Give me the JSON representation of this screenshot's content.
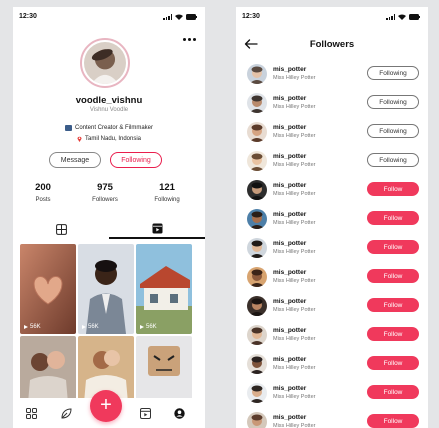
{
  "status": {
    "time": "12:30"
  },
  "profile": {
    "username": "voodle_vishnu",
    "full_name": "Vishnu Voodle",
    "bio_line_1": "Content Creator & Filmmaker",
    "bio_line_2": "Tamil Nadu, Indonsia",
    "message_label": "Message",
    "following_label": "Following",
    "stats": [
      {
        "value": "200",
        "label": "Posts"
      },
      {
        "value": "975",
        "label": "Followers"
      },
      {
        "value": "121",
        "label": "Following"
      }
    ],
    "grid": [
      {
        "views": "56K"
      },
      {
        "views": "56K"
      },
      {
        "views": "56K"
      },
      {
        "views": ""
      },
      {
        "views": ""
      },
      {
        "views": ""
      }
    ]
  },
  "followers": {
    "title": "Followers",
    "items": [
      {
        "username": "mis_potter",
        "name": "Miss Hilley Potter",
        "button": "Following",
        "state": "following"
      },
      {
        "username": "mis_potter",
        "name": "Miss Hilley Potter",
        "button": "Following",
        "state": "following"
      },
      {
        "username": "mis_potter",
        "name": "Miss Hilley Potter",
        "button": "Following",
        "state": "following"
      },
      {
        "username": "mis_potter",
        "name": "Miss Hilley Potter",
        "button": "Following",
        "state": "following"
      },
      {
        "username": "mis_potter",
        "name": "Miss Hilley Potter",
        "button": "Follow",
        "state": "follow"
      },
      {
        "username": "mis_potter",
        "name": "Miss Hilley Potter",
        "button": "Follow",
        "state": "follow"
      },
      {
        "username": "mis_potter",
        "name": "Miss Hilley Potter",
        "button": "Follow",
        "state": "follow"
      },
      {
        "username": "mis_potter",
        "name": "Miss Hilley Potter",
        "button": "Follow",
        "state": "follow"
      },
      {
        "username": "mis_potter",
        "name": "Miss Hilley Potter",
        "button": "Follow",
        "state": "follow"
      },
      {
        "username": "mis_potter",
        "name": "Miss Hilley Potter",
        "button": "Follow",
        "state": "follow"
      },
      {
        "username": "mis_potter",
        "name": "Miss Hilley Potter",
        "button": "Follow",
        "state": "follow"
      },
      {
        "username": "mis_potter",
        "name": "Miss Hilley Potter",
        "button": "Follow",
        "state": "follow"
      },
      {
        "username": "mis_potter",
        "name": "Miss Hilley Potter",
        "button": "Follow",
        "state": "follow"
      }
    ]
  },
  "colors": {
    "accent": "#f0395c",
    "avatar_ring": "#e8b5c1"
  },
  "icons": {
    "profile_more": "more-horizontal-icon",
    "tab_1": "grid-icon",
    "tab_2": "reels-icon",
    "nav": [
      "home-grid-icon",
      "explore-icon",
      "create-plus-icon",
      "reels-icon",
      "profile-icon"
    ],
    "back": "arrow-left-icon"
  }
}
